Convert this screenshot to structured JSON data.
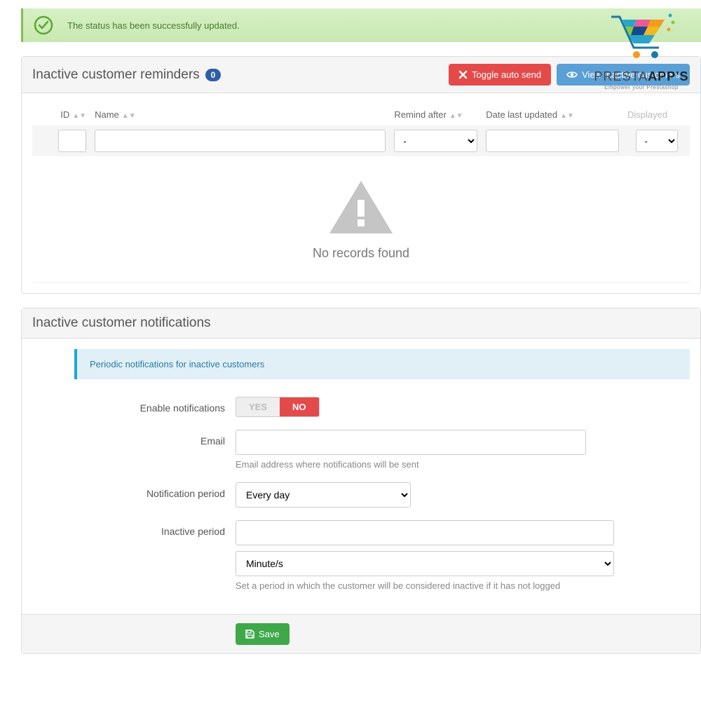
{
  "alert": {
    "message": "The status has been successfully updated."
  },
  "logo": {
    "brand1": "PRESTA",
    "brand2": "APP'S",
    "tagline": "Empower your Prestashop"
  },
  "reminders": {
    "title": "Inactive customer reminders",
    "count": "0",
    "toggle_btn": "Toggle auto send",
    "view_btn": "View Inactive customers",
    "cols": {
      "id": "ID",
      "name": "Name",
      "remind": "Remind after",
      "date": "Date last updated",
      "displayed": "Displayed"
    },
    "filter_dash": "-",
    "empty": "No records found"
  },
  "notifications": {
    "title": "Inactive customer notifications",
    "info": "Periodic notifications for inactive customers",
    "enable_label": "Enable notifications",
    "toggle": {
      "yes": "YES",
      "no": "NO"
    },
    "email_label": "Email",
    "email_help": "Email address where notifications will be sent",
    "period_label": "Notification period",
    "period_value": "Every day",
    "inactive_label": "Inactive period",
    "inactive_unit": "Minute/s",
    "inactive_help": "Set a period in which the customer will be considered inactive if it has not logged",
    "save": "Save"
  }
}
